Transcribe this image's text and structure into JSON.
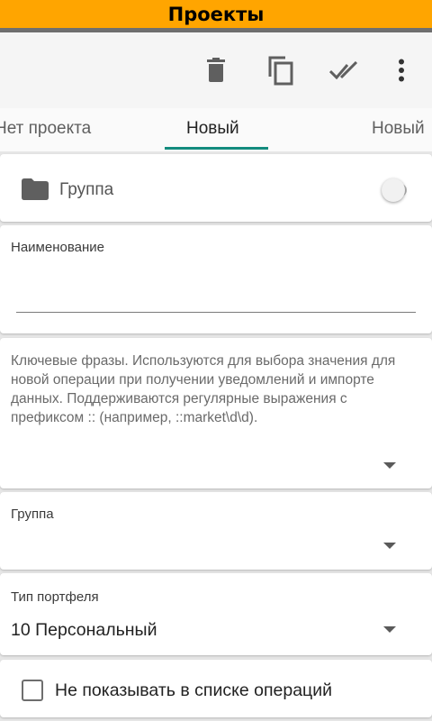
{
  "app": {
    "title": "Проекты",
    "accent_color": "#ffa500",
    "tab_indicator_color": "#138b7e"
  },
  "toolbar": {
    "actions": [
      {
        "name": "delete",
        "icon": "trash-icon"
      },
      {
        "name": "copy",
        "icon": "copy-icon"
      },
      {
        "name": "done-all",
        "icon": "double-check-icon"
      },
      {
        "name": "more",
        "icon": "more-vert-icon"
      }
    ]
  },
  "tabs": [
    {
      "label": "Нет проекта",
      "active": false
    },
    {
      "label": "Новый",
      "active": true
    },
    {
      "label": "Новый",
      "active": false
    }
  ],
  "group_toggle": {
    "icon": "folder-icon",
    "label": "Группа",
    "enabled": false
  },
  "name_field": {
    "label": "Наименование",
    "value": ""
  },
  "keywords_field": {
    "description": "Ключевые фразы. Используются для выбора значения для новой операции при получении уведомлений и импорте данных. Поддерживаются регулярные выражения с префиксом :: (например, ::market\\d\\d).",
    "value": ""
  },
  "group_field": {
    "label": "Группа",
    "value": ""
  },
  "portfolio_field": {
    "label": "Тип портфеля",
    "value": "10 Персональный"
  },
  "hide_checkbox": {
    "label": "Не показывать в списке операций",
    "checked": false
  }
}
